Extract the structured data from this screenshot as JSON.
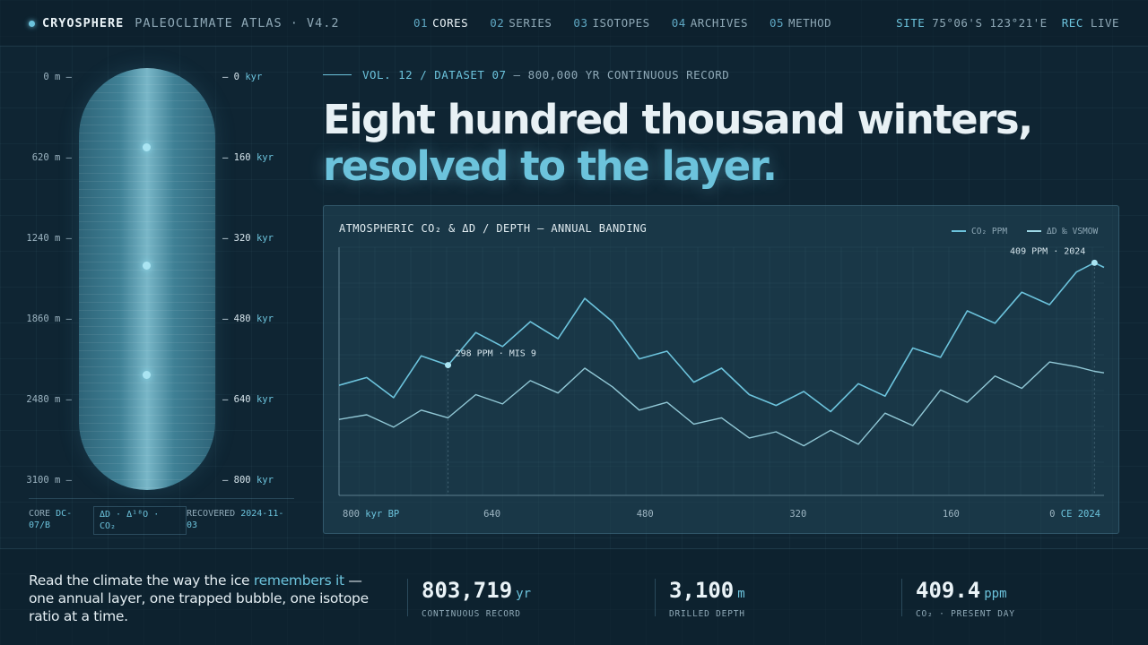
{
  "brand": {
    "name": "CRYOSPHERE",
    "subtitle": "PALEOCLIMATE ATLAS · V4.2"
  },
  "nav": [
    {
      "num": "01",
      "label": "CORES",
      "active": true
    },
    {
      "num": "02",
      "label": "SERIES",
      "active": false
    },
    {
      "num": "03",
      "label": "ISOTOPES",
      "active": false
    },
    {
      "num": "04",
      "label": "ARCHIVES",
      "active": false
    },
    {
      "num": "05",
      "label": "METHOD",
      "active": false
    }
  ],
  "site": {
    "site_label": "SITE",
    "coords": "75°06'S 123°21'E",
    "rec_label": "REC",
    "rec_value": "LIVE"
  },
  "core": {
    "depth_ticks": [
      "0 m",
      "620 m",
      "1240 m",
      "1860 m",
      "2480 m",
      "3100 m"
    ],
    "age_ticks": [
      {
        "value": "0",
        "unit": "kyr"
      },
      {
        "value": "160",
        "unit": "kyr"
      },
      {
        "value": "320",
        "unit": "kyr"
      },
      {
        "value": "480",
        "unit": "kyr"
      },
      {
        "value": "640",
        "unit": "kyr"
      },
      {
        "value": "800",
        "unit": "kyr"
      }
    ],
    "footer": {
      "core_label": "CORE",
      "core_id": "DC-07/B",
      "proxies": "ΔD · Δ¹⁸O · CO₂",
      "recovered_label": "RECOVERED",
      "recovered_date": "2024-11-03"
    }
  },
  "hero": {
    "kicker_accent": "VOL. 12 / DATASET 07",
    "kicker_rest": "— 800,000 YR CONTINUOUS RECORD",
    "headline_1": "Eight hundred thousand winters,",
    "headline_2": "resolved to the layer."
  },
  "chart_data": {
    "type": "line",
    "title": "ATMOSPHERIC CO₂ & ΔD / DEPTH — ANNUAL BANDING",
    "legend_position": "top-right",
    "x_tick_labels": [
      {
        "value": "800",
        "unit": "kyr BP"
      },
      {
        "value": "640",
        "unit": ""
      },
      {
        "value": "480",
        "unit": ""
      },
      {
        "value": "320",
        "unit": ""
      },
      {
        "value": "160",
        "unit": ""
      },
      {
        "value": "0",
        "unit": "CE 2024"
      }
    ],
    "x": [
      800,
      771,
      743,
      714,
      686,
      657,
      629,
      600,
      571,
      543,
      514,
      486,
      457,
      429,
      400,
      371,
      343,
      314,
      286,
      257,
      229,
      200,
      171,
      143,
      114,
      86,
      57,
      29,
      10,
      0
    ],
    "xlim": [
      800,
      0
    ],
    "series": [
      {
        "name": "CO₂ PPM",
        "color": "#6cc3dc",
        "values": [
          221,
          226,
          213,
          240,
          234,
          255,
          246,
          262,
          251,
          277,
          262,
          238,
          243,
          223,
          232,
          215,
          208,
          217,
          204,
          222,
          214,
          245,
          239,
          269,
          261,
          281,
          273,
          294,
          300,
          297
        ]
      },
      {
        "name": "ΔD ‰ VSMOW",
        "color": "#9ed8e6",
        "values": [
          199,
          202,
          194,
          205,
          200,
          215,
          209,
          224,
          216,
          232,
          220,
          205,
          210,
          196,
          200,
          187,
          191,
          182,
          192,
          183,
          203,
          195,
          218,
          210,
          227,
          219,
          236,
          233,
          230,
          229
        ]
      }
    ],
    "annotations": [
      {
        "text": "298 PPM · MIS 9",
        "x": 686
      },
      {
        "text": "409 PPM · 2024",
        "x": 10
      }
    ]
  },
  "footer": {
    "quote_pre": "Read the climate the way the ice",
    "quote_hl": "remembers it",
    "quote_post": "— one annual layer, one trapped bubble, one isotope ratio at a time.",
    "stats": [
      {
        "value": "803,719",
        "unit": "yr",
        "label": "CONTINUOUS RECORD"
      },
      {
        "value": "3,100",
        "unit": "m",
        "label": "DRILLED DEPTH"
      },
      {
        "value": "409.4",
        "unit": "ppm",
        "label": "CO₂ · PRESENT DAY"
      }
    ]
  }
}
